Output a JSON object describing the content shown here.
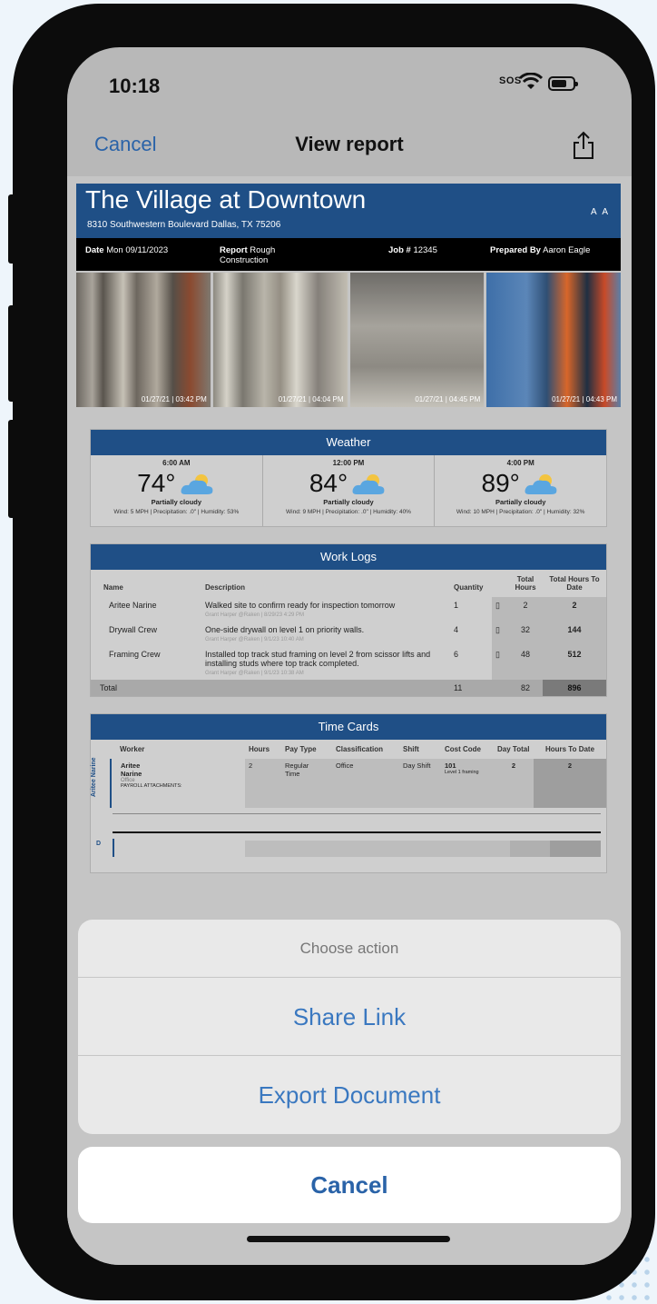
{
  "status": {
    "time": "10:18",
    "sos": "SOS"
  },
  "nav": {
    "cancel": "Cancel",
    "title": "View report"
  },
  "report": {
    "title": "The Village at Downtown",
    "address": "8310 Southwestern Boulevard Dallas, TX 75206",
    "aa": "A A",
    "meta": {
      "date_label": "Date",
      "date_value": "Mon 09/11/2023",
      "report_label": "Report",
      "report_value_1": "Rough",
      "report_value_2": "Construction",
      "job_label": "Job #",
      "job_value": "12345",
      "prepared_label": "Prepared By",
      "prepared_value": "Aaron Eagle"
    },
    "photos": [
      {
        "stamp": "01/27/21 | 03:42 PM"
      },
      {
        "stamp": "01/27/21 | 04:04 PM"
      },
      {
        "stamp": "01/27/21 | 04:45 PM"
      },
      {
        "stamp": "01/27/21 | 04:43 PM"
      }
    ]
  },
  "weather": {
    "title": "Weather",
    "slots": [
      {
        "time": "6:00 AM",
        "temp": "74°",
        "desc": "Partially cloudy",
        "wind": "Wind: 5 MPH",
        "precip": "Precipitation: .0\"",
        "humidity": "Humidity: 53%"
      },
      {
        "time": "12:00 PM",
        "temp": "84°",
        "desc": "Partially cloudy",
        "wind": "Wind: 9 MPH",
        "precip": "Precipitation: .0\"",
        "humidity": "Humidity: 40%"
      },
      {
        "time": "4:00 PM",
        "temp": "89°",
        "desc": "Partially cloudy",
        "wind": "Wind: 10 MPH",
        "precip": "Precipitation: .0\"",
        "humidity": "Humidity: 32%"
      }
    ]
  },
  "worklogs": {
    "title": "Work Logs",
    "headers": {
      "name": "Name",
      "description": "Description",
      "quantity": "Quantity",
      "total_hours": "Total Hours",
      "total_to_date": "Total Hours To Date"
    },
    "rows": [
      {
        "name": "Aritee Narine",
        "description": "Walked site to confirm ready for inspection tomorrow",
        "sub": "Grant Harper @Raken | 8/29/23 4:29 PM",
        "quantity": "1",
        "hours": "2",
        "to_date": "2"
      },
      {
        "name": "Drywall Crew",
        "description": "One-side drywall on level 1 on priority walls.",
        "sub": "Grant Harper @Raken | 9/1/23 10:40 AM",
        "quantity": "4",
        "hours": "32",
        "to_date": "144"
      },
      {
        "name": "Framing Crew",
        "description": "Installed top track stud framing on level 2 from scissor lifts and installing studs where top track completed.",
        "sub": "Grant Harper @Raken | 9/1/23 10:38 AM",
        "quantity": "6",
        "hours": "48",
        "to_date": "512"
      }
    ],
    "total": {
      "label": "Total",
      "quantity": "11",
      "hours": "82",
      "to_date": "896"
    }
  },
  "timecards": {
    "title": "Time Cards",
    "headers": {
      "worker": "Worker",
      "hours": "Hours",
      "pay_type": "Pay Type",
      "classification": "Classification",
      "shift": "Shift",
      "cost_code": "Cost Code",
      "day_total": "Day Total",
      "hours_to_date": "Hours To Date"
    },
    "side_label": "Aritee Narine",
    "side_label_2": "D",
    "row": {
      "worker_1": "Aritee",
      "worker_2": "Narine",
      "worker_sub": "Office",
      "attachments": "PAYROLL ATTACHMENTS:",
      "hours": "2",
      "pay_type_1": "Regular",
      "pay_type_2": "Time",
      "classification": "Office",
      "shift": "Day Shift",
      "cost_code": "101",
      "cost_code_sub": "Level 1 framing",
      "day_total": "2",
      "to_date": "2"
    }
  },
  "sheet": {
    "title": "Choose action",
    "share_link": "Share Link",
    "export": "Export Document",
    "cancel": "Cancel"
  }
}
